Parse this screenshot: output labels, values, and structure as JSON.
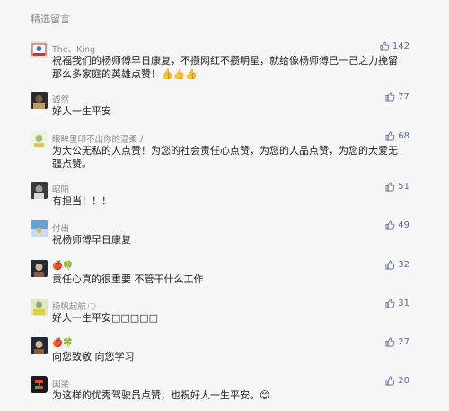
{
  "section_title": "精选留言",
  "comments": [
    {
      "nickname": "The、King",
      "content": "祝福我们的杨师傅早日康复，不攒网红不攒明星，就给像杨师傅已一己之力挽留那么多家庭的英雄点赞！👍👍👍",
      "likes": "142",
      "avatar_colors": [
        "#e8e3d6",
        "#c7362f",
        "#3b7cc4"
      ]
    },
    {
      "nickname": "诚然",
      "content": "好人一生平安",
      "likes": "77",
      "avatar_colors": [
        "#2b2b2b",
        "#7a5a3a",
        "#c49a5e"
      ]
    },
    {
      "nickname": "眼眸里印不出你的温柔丿",
      "content": "为大公无私的人点赞！为您的社会责任心点赞，为您的人品点赞，为您的大爱无疆点赞。",
      "likes": "68",
      "avatar_colors": [
        "#eef3e6",
        "#9cc46a",
        "#e3c35a"
      ]
    },
    {
      "nickname": "昭阳",
      "content": "有担当！！！",
      "likes": "51",
      "avatar_colors": [
        "#3a3a3a",
        "#9c9c9c",
        "#d8d8d8"
      ]
    },
    {
      "nickname": "付出",
      "content": "祝杨师傅早日康复",
      "likes": "49",
      "avatar_colors": [
        "#6aa0d8",
        "#c8dcef",
        "#e0b85a"
      ]
    },
    {
      "nickname": "🍎🍀",
      "content": "责任心真的很重要    不管干什么工作",
      "likes": "32",
      "avatar_colors": [
        "#1f2a38",
        "#d9b48a",
        "#8a5a3a"
      ]
    },
    {
      "nickname": "扬帆起航🗨",
      "content": "好人一生平安□□□□□",
      "likes": "31",
      "avatar_colors": [
        "#e7e3c9",
        "#8ab35a",
        "#d8d04a"
      ]
    },
    {
      "nickname": "🍎🍀",
      "content": "向您致敬    向您学习",
      "likes": "27",
      "avatar_colors": [
        "#1f2a38",
        "#d9b48a",
        "#8a5a3a"
      ]
    },
    {
      "nickname": "国梁",
      "content": "为这样的优秀驾驶员点赞，也祝好人一生平安。😊",
      "likes": "20",
      "avatar_colors": [
        "#1a1a1a",
        "#e34a3a",
        "#4aa85a"
      ]
    }
  ],
  "colors": {
    "like_blue": "#576b95",
    "nickname_gray": "#8a8a8a",
    "text": "#222222"
  }
}
